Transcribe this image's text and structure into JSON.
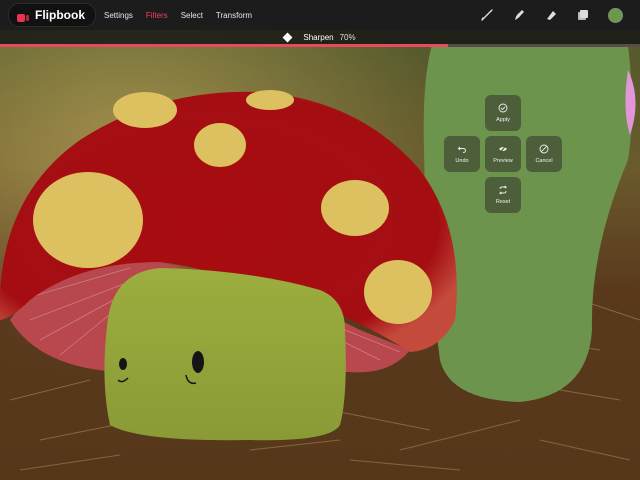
{
  "app": {
    "name": "Flipbook",
    "brand_color": "#e8354f"
  },
  "menu": [
    {
      "label": "Settings",
      "active": false
    },
    {
      "label": "Filters",
      "active": true
    },
    {
      "label": "Select",
      "active": false
    },
    {
      "label": "Transform",
      "active": false
    }
  ],
  "toolbar": {
    "icons": [
      "brush-icon",
      "smudge-icon",
      "eraser-icon",
      "layers-icon"
    ],
    "color": "#6a9a46"
  },
  "adjustment": {
    "name": "Sharpen",
    "value_label": "70%",
    "value": 0.7,
    "slider_color": "#e84a5f"
  },
  "controls": {
    "apply": {
      "label": "Apply",
      "icon": "check-circle-icon"
    },
    "undo": {
      "label": "Undo",
      "icon": "undo-icon"
    },
    "preview": {
      "label": "Preview",
      "icon": "eye-slash-icon"
    },
    "cancel": {
      "label": "Cancel",
      "icon": "no-circle-icon"
    },
    "reset": {
      "label": "Reset",
      "icon": "reset-icon"
    }
  }
}
